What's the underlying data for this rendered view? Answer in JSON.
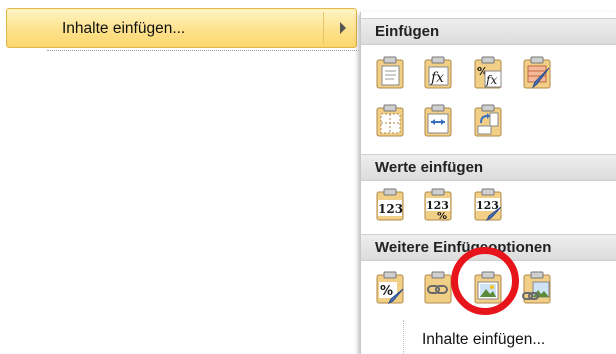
{
  "menu": {
    "paste_special_label": "Inhalte einfügen..."
  },
  "submenu": {
    "sections": [
      {
        "title": "Einfügen"
      },
      {
        "title": "Werte einfügen"
      },
      {
        "title": "Weitere Einfügeoptionen"
      }
    ],
    "icons": {
      "paste": "clipboard-paste-icon",
      "formulas": "clipboard-formula-icon",
      "formulas_number_format": "clipboard-formula-percent-icon",
      "keep_source_formatting": "clipboard-brush-icon",
      "no_borders": "clipboard-no-borders-icon",
      "keep_column_widths": "clipboard-column-width-icon",
      "transpose": "clipboard-transpose-icon",
      "values": "clipboard-values-icon",
      "values_number_format": "clipboard-values-percent-icon",
      "values_source_formatting": "clipboard-values-brush-icon",
      "formatting": "clipboard-percent-brush-icon",
      "paste_link": "clipboard-link-icon",
      "picture": "clipboard-picture-icon",
      "linked_picture": "clipboard-linked-picture-icon"
    },
    "bottom_label": "Inhalte einfügen...",
    "highlight_color": "#e8141b"
  }
}
